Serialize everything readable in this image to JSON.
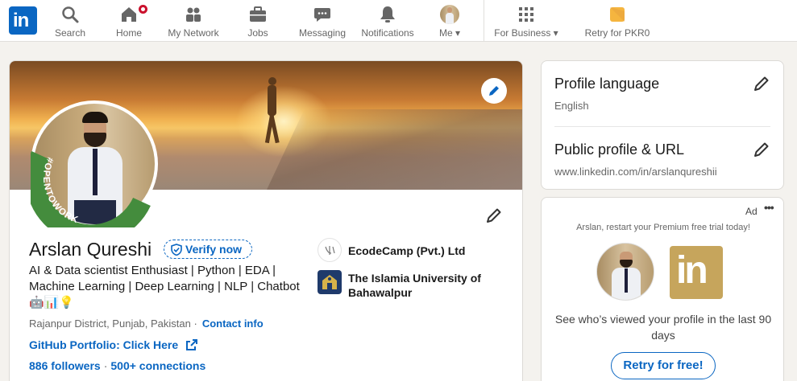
{
  "nav": {
    "items": [
      {
        "label": "Search",
        "icon": "search-icon"
      },
      {
        "label": "Home",
        "icon": "home-icon"
      },
      {
        "label": "My Network",
        "icon": "network-icon"
      },
      {
        "label": "Jobs",
        "icon": "briefcase-icon"
      },
      {
        "label": "Messaging",
        "icon": "message-icon"
      },
      {
        "label": "Notifications",
        "icon": "bell-icon"
      },
      {
        "label": "Me",
        "icon": "avatar"
      },
      {
        "label": "For Business",
        "icon": "grid-icon"
      },
      {
        "label": "Retry for PKR0",
        "icon": "premium-icon"
      }
    ],
    "logo": "in",
    "accent": "#0a66c2",
    "badge_color": "#cb112d"
  },
  "profile": {
    "name": "Arslan Qureshi",
    "verify_label": "Verify now",
    "headline": "AI & Data scientist Enthusiast | Python | EDA | Machine Learning | Deep Learning | NLP | Chatbot🤖📊💡",
    "location": "Rajanpur District, Punjab, Pakistan ·",
    "contact_label": "Contact info",
    "github_label": "GitHub Portfolio: Click Here",
    "followers": "886 followers",
    "separator": "·",
    "connections": "500+ connections",
    "open_to_work": "#OPENTOWORK",
    "orgs": [
      {
        "name": "EcodeCamp (Pvt.) Ltd"
      },
      {
        "name": "The Islamia University of Bahawalpur"
      }
    ]
  },
  "sidebar": {
    "profile_language_title": "Profile language",
    "profile_language_value": "English",
    "public_profile_title": "Public profile & URL",
    "public_profile_url": "www.linkedin.com/in/arslanqureshii"
  },
  "ad": {
    "tag": "Ad",
    "more": "•••",
    "line": "Arslan, restart your Premium free trial today!",
    "body": "See who’s viewed your profile in the last 90 days",
    "button": "Retry for free!",
    "logo": "in"
  }
}
